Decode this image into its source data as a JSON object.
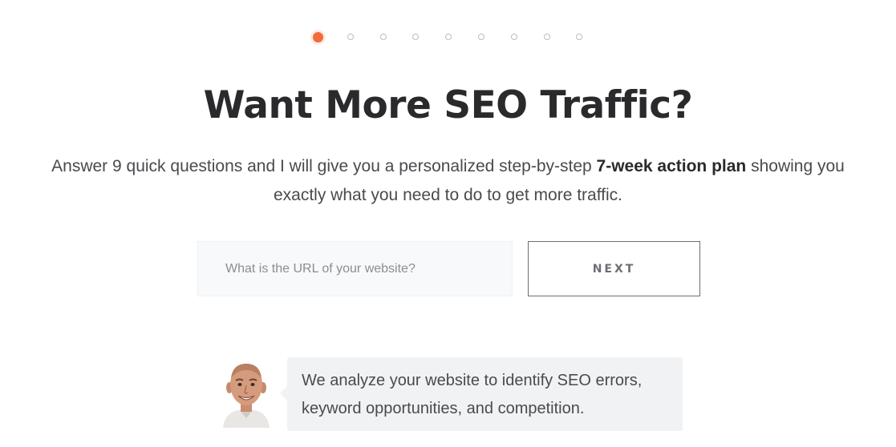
{
  "progress": {
    "total_steps": 9,
    "current_step": 1,
    "accent_color": "#f26b3a"
  },
  "hero": {
    "title": "Want More SEO Traffic?",
    "subtitle_part1": "Answer 9 quick questions and I will give you a personalized step-by-step ",
    "subtitle_bold": "7-week action plan",
    "subtitle_part2": " showing you exactly what you need to do to get more traffic."
  },
  "form": {
    "url_placeholder": "What is the URL of your website?",
    "url_value": "",
    "next_label": "NEXT"
  },
  "chat": {
    "avatar_icon": "person-avatar",
    "message": "We analyze your website to identify SEO errors, keyword opportunities, and competition."
  }
}
